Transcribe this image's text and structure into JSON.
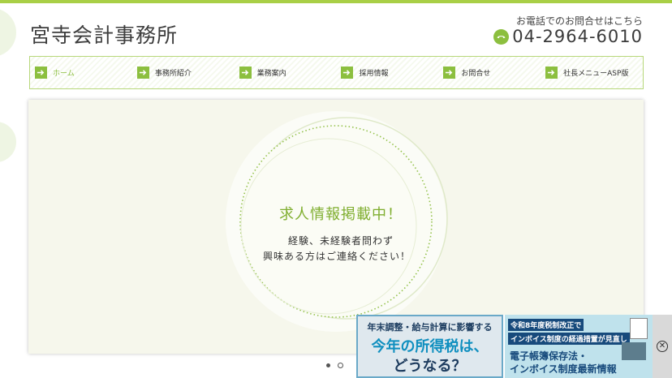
{
  "header": {
    "site_title": "宮寺会計事務所",
    "contact_label": "お電話でのお問合せはこちら",
    "phone_number": "04-2964-6010"
  },
  "nav": {
    "items": [
      {
        "label": "ホーム",
        "active": true
      },
      {
        "label": "事務所紹介",
        "active": false
      },
      {
        "label": "業務案内",
        "active": false
      },
      {
        "label": "採用情報",
        "active": false
      },
      {
        "label": "お問合せ",
        "active": false
      },
      {
        "label": "社長メニューASP版",
        "active": false
      }
    ]
  },
  "hero": {
    "heading": "求人情報掲載中！",
    "line1": "経験、未経験者問わず",
    "line2": "興味ある方はご連絡ください！"
  },
  "slider": {
    "dots": [
      "filled",
      "empty"
    ]
  },
  "ad": {
    "left_line1": "年末調整・給与計算に影響する",
    "left_line2": "今年の所得税は、",
    "left_line3": "どうなる？",
    "right_tag1": "令和8年度税制改正で",
    "right_tag2": "インボイス制度の経過措置が見直し",
    "right_line1": "電子帳簿保存法・",
    "right_line2": "インボイス制度最新情報",
    "close_symbol": "✕"
  },
  "colors": {
    "accent_green": "#8cbf3f",
    "top_bar": "#a9cf46",
    "hero_bg": "#f6f7ec",
    "ad_blue": "#174a7c"
  }
}
